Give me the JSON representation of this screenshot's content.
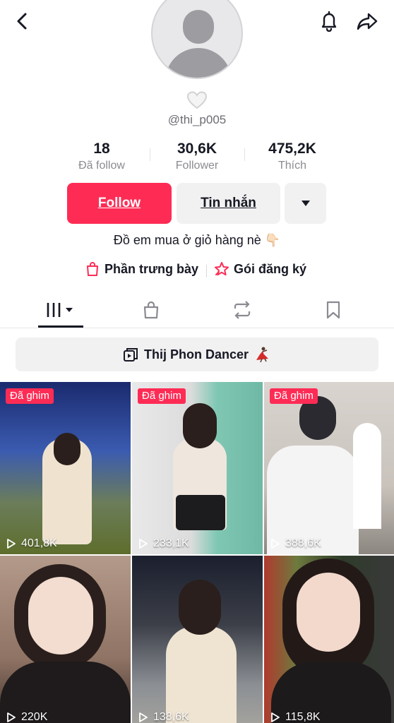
{
  "header": {
    "back_icon": "chevron-left-icon",
    "bell_icon": "bell-icon",
    "share_icon": "share-arrow-icon"
  },
  "profile": {
    "username": "@thi_p005",
    "stats": [
      {
        "value": "18",
        "label": "Đã follow"
      },
      {
        "value": "30,6K",
        "label": "Follower"
      },
      {
        "value": "475,2K",
        "label": "Thích"
      }
    ],
    "buttons": {
      "follow": "Follow",
      "message": "Tin nhắn",
      "more_icon": "caret-down-icon"
    },
    "bio": "Đồ em mua ở giỏ hàng  nè 👇🏻",
    "links": {
      "shop": "Phần trưng bày",
      "subscription": "Gói đăng ký"
    }
  },
  "tabs": [
    {
      "icon": "videos-grid-icon",
      "active": true
    },
    {
      "icon": "shopping-bag-icon",
      "active": false
    },
    {
      "icon": "repost-icon",
      "active": false
    },
    {
      "icon": "bookmark-icon",
      "active": false
    }
  ],
  "playlist": {
    "label": "Thij Phon Dancer",
    "icon": "playlist-icon",
    "emoji": "dancer-emoji"
  },
  "videos": [
    {
      "pinned": "Đã ghim",
      "views": "401,8K"
    },
    {
      "pinned": "Đã ghim",
      "views": "233,1K"
    },
    {
      "pinned": "Đã ghim",
      "views": "388,6K"
    },
    {
      "pinned": "",
      "views": "220K"
    },
    {
      "pinned": "",
      "views": "138,6K"
    },
    {
      "pinned": "",
      "views": "115,8K"
    }
  ],
  "colors": {
    "accent": "#fe2c55",
    "text": "#161823",
    "muted": "#8a8b91",
    "button_bg": "#f1f1f2"
  }
}
